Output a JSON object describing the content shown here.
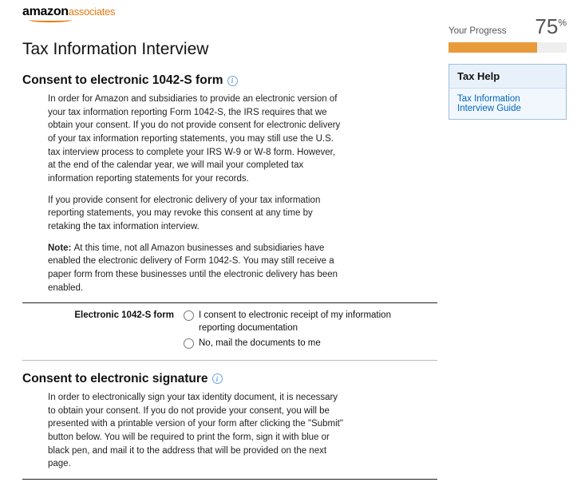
{
  "logo": {
    "brand": "amazon",
    "sub": "associates"
  },
  "page_title": "Tax Information Interview",
  "sections": [
    {
      "heading": "Consent to electronic 1042-S form",
      "paras": [
        "In order for Amazon and subsidiaries to provide an electronic version of your tax information reporting Form 1042-S, the IRS requires that we obtain your consent. If you do not provide consent for electronic delivery of your tax information reporting statements, you may still use the U.S. tax interview process to complete your IRS W-9 or W-8 form. However, at the end of the calendar year, we will mail your completed tax information reporting statements for your records.",
        "If you provide consent for electronic delivery of your tax information reporting statements, you may revoke this consent at any time by retaking the tax information interview."
      ],
      "note": {
        "prefix": "Note: ",
        "text": "At this time, not all Amazon businesses and subsidiaries have enabled the electronic delivery of Form 1042-S. You may still receive a paper form from these businesses until the electronic delivery has been enabled."
      },
      "field": {
        "label": "Electronic 1042-S form",
        "options": [
          "I consent to electronic receipt of my information reporting documentation",
          "No, mail the documents to me"
        ]
      }
    },
    {
      "heading": "Consent to electronic signature",
      "paras": [
        "In order to electronically sign your tax identity document, it is necessary to obtain your consent. If you do not provide your consent, you will be presented with a printable version of your form after clicking the \"Submit\" button below. You will be required to print the form, sign it with blue or black pen, and mail it to the address that will be provided on the next page."
      ]
    }
  ],
  "sidebar": {
    "progress_label": "Your Progress",
    "progress_value": "75",
    "progress_pct": 75,
    "help_title": "Tax Help",
    "help_link": "Tax Information Interview Guide"
  }
}
